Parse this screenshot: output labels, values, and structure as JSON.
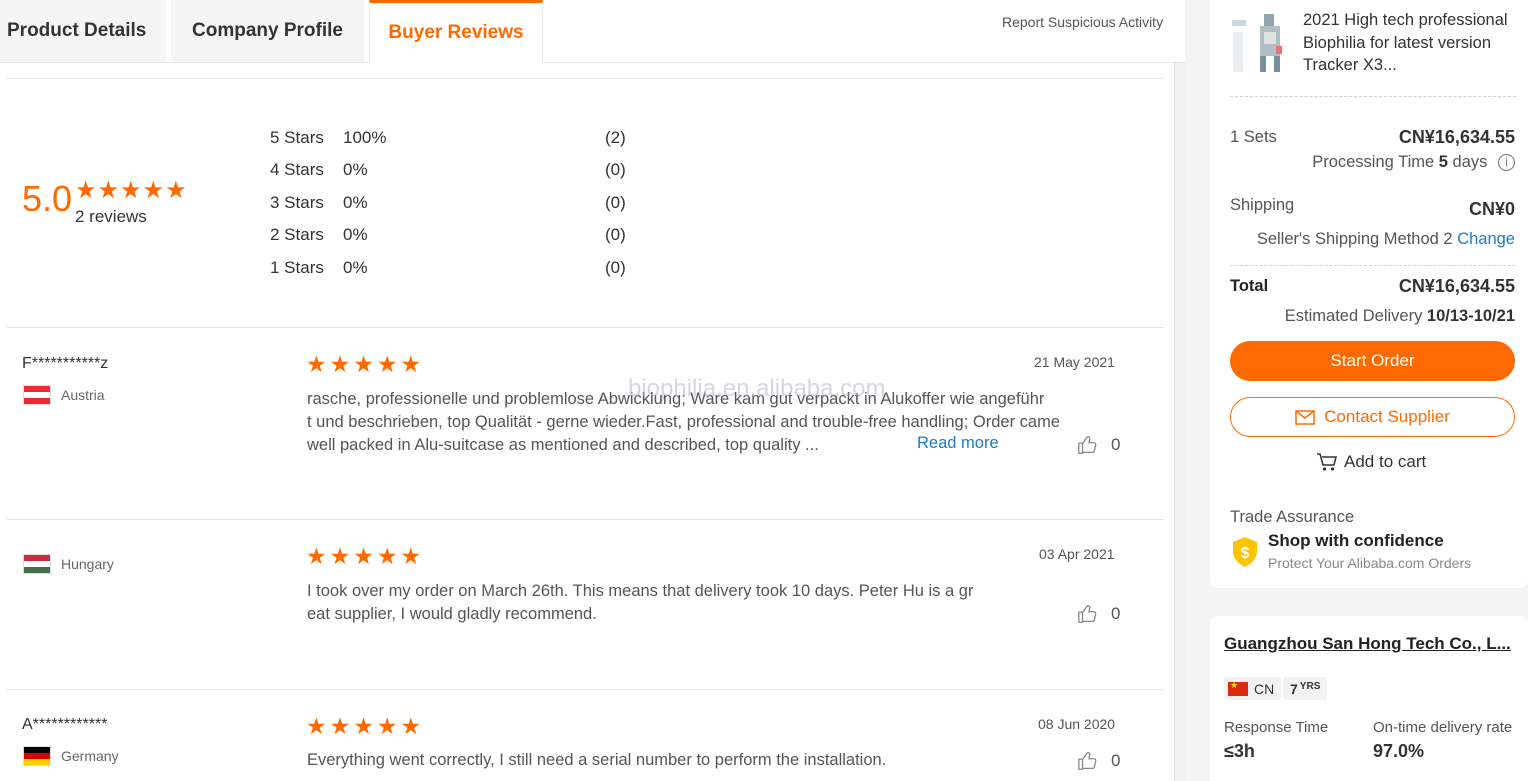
{
  "tabs": [
    {
      "label": "Product Details"
    },
    {
      "label": "Company Profile"
    },
    {
      "label": "Buyer Reviews"
    }
  ],
  "report_link": "Report Suspicious Activity",
  "summary": {
    "score": "5.0",
    "review_count": "2 reviews",
    "rating_stars": 5,
    "distribution": [
      {
        "label": "5  Stars",
        "percent": "100%",
        "count": "(2)"
      },
      {
        "label": "4  Stars",
        "percent": "0%",
        "count": "(0)"
      },
      {
        "label": "3  Stars",
        "percent": "0%",
        "count": "(0)"
      },
      {
        "label": "2  Stars",
        "percent": "0%",
        "count": "(0)"
      },
      {
        "label": "1  Stars",
        "percent": "0%",
        "count": "(0)"
      }
    ]
  },
  "watermark": "biophilia.en.alibaba.com",
  "reviews": [
    {
      "name": "F***********z",
      "country": "Austria",
      "stars": 5,
      "date": "21 May 2021",
      "lines": [
        "rasche, professionelle und problemlose Abwicklung; Ware kam gut verpackt in Alukoffer wie angeführ",
        "t und beschrieben, top Qualität - gerne wieder.Fast, professional and trouble-free handling; Order came",
        "well packed in Alu-suitcase as mentioned and described, top quality ..."
      ],
      "read_more": "Read more",
      "likes": "0"
    },
    {
      "name": "",
      "country": "Hungary",
      "stars": 5,
      "date": "03 Apr 2021",
      "lines": [
        "I took over my order on March 26th.  This means that delivery took 10 days.  Peter Hu is a gr",
        "eat supplier, I would gladly recommend."
      ],
      "likes": "0"
    },
    {
      "name": "A************",
      "country": "Germany",
      "stars": 5,
      "date": "08 Jun 2020",
      "lines": [
        "Everything went correctly, I still need a serial number to perform the installation."
      ],
      "likes": "0"
    }
  ],
  "order_card": {
    "product_title": "2021 High tech professional Biophilia for latest version Tracker X3...",
    "quantity": "1 Sets",
    "price": "CN¥16,634.55",
    "processing_label": "Processing Time",
    "processing_days": "5",
    "processing_unit": "days",
    "shipping_label": "Shipping",
    "shipping_price": "CN¥0",
    "shipping_method": "Seller's Shipping Method 2",
    "change_label": "Change",
    "total_label": "Total",
    "total_price": "CN¥16,634.55",
    "delivery_label": "Estimated Delivery",
    "delivery_dates": "10/13-10/21",
    "start_order": "Start Order",
    "contact_supplier": "Contact Supplier",
    "add_to_cart": "Add to cart",
    "trade_assurance": "Trade Assurance",
    "ta_headline": "Shop with confidence",
    "ta_sub": "Protect Your Alibaba.com Orders"
  },
  "supplier_card": {
    "company_name": "Guangzhou San Hong Tech Co., L...",
    "country_code": "CN",
    "years": "7",
    "years_unit": "YRS",
    "response_label": "Response Time",
    "response_value": "≤3h",
    "ontime_label": "On-time delivery rate",
    "ontime_value": "97.0%"
  },
  "colors": {
    "accent": "#ff6a00",
    "link": "#1b7bc4"
  }
}
